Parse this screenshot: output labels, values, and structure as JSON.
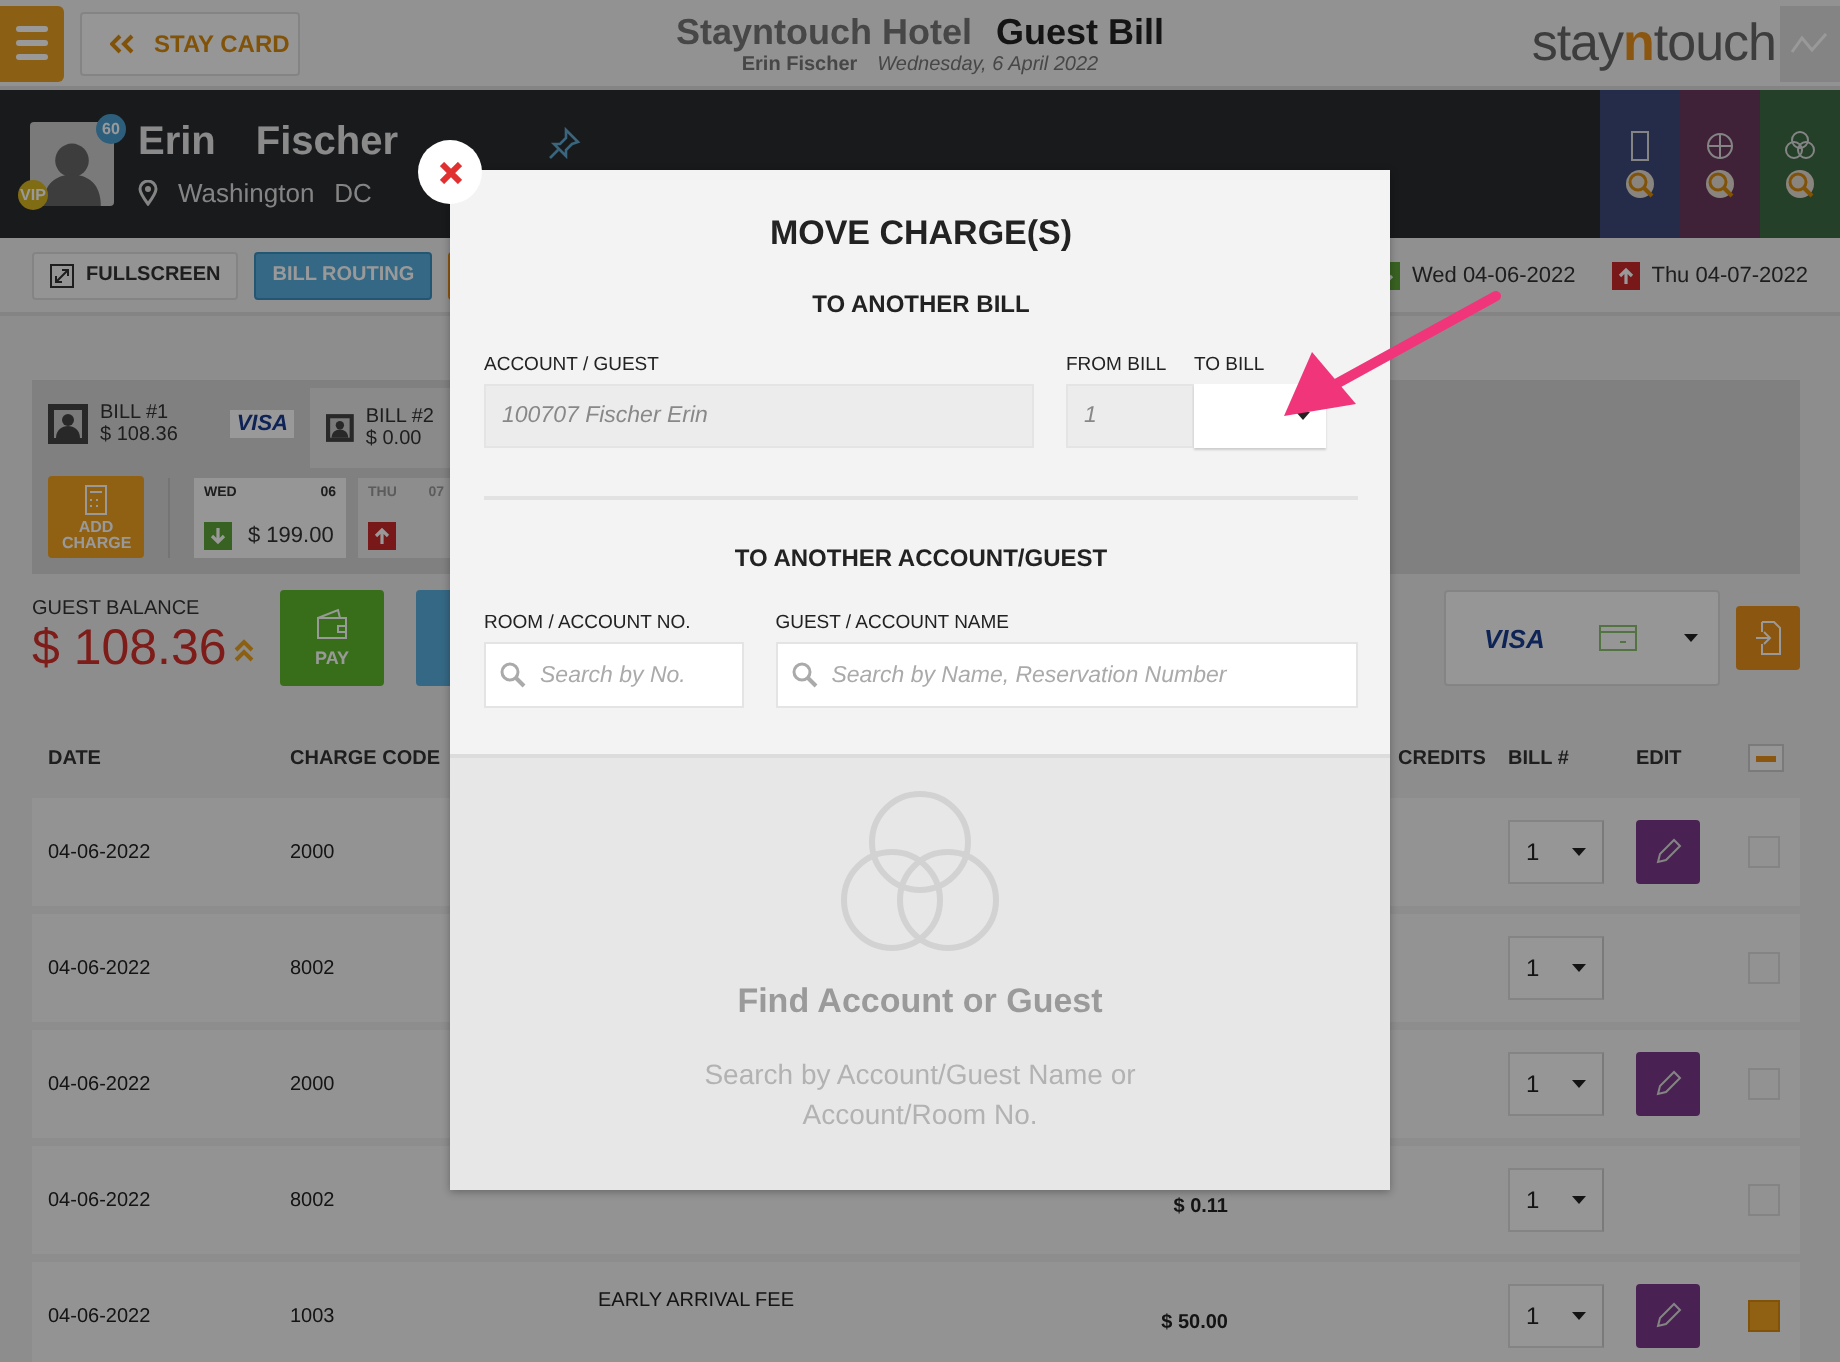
{
  "header": {
    "back_button": "STAY CARD",
    "hotel": "Stayntouch Hotel",
    "page_title": "Guest Bill",
    "guest_name": "Erin Fischer",
    "date": "Wednesday, 6 April 2022",
    "logo": {
      "before": "stay",
      "accent": "n",
      "after": "touch"
    }
  },
  "guest": {
    "first_name": "Erin",
    "last_name": "Fischer",
    "city": "Washington",
    "state": "DC",
    "loyalty_points": "60",
    "vip_badge": "VIP"
  },
  "toolbar": {
    "buttons": [
      {
        "label": "FULLSCREEN",
        "kind": "fullscreen"
      },
      {
        "label": "BILL ROUTING",
        "kind": "routing"
      }
    ],
    "arrival": "Wed 04-06-2022",
    "departure": "Thu 04-07-2022"
  },
  "bills": [
    {
      "label": "BILL #1",
      "amount": "$ 108.36",
      "selected": true,
      "card": "VISA"
    },
    {
      "label": "BILL #2",
      "amount": "$ 0.00",
      "selected": false
    }
  ],
  "add_charge": "ADD CHARGE",
  "days": [
    {
      "day": "WED",
      "date": "06",
      "amount": "$ 199.00",
      "kind": "arrival",
      "selected": true
    },
    {
      "day": "THU",
      "date": "07",
      "kind": "departure",
      "selected": false
    }
  ],
  "balance": {
    "label": "GUEST BALANCE",
    "amount": "$ 108.36",
    "pay": "PAY",
    "card": "VISA"
  },
  "table": {
    "headers": {
      "date": "DATE",
      "code": "CHARGE CODE",
      "credits": "CREDITS",
      "bill": "BILL #",
      "edit": "EDIT"
    },
    "select_all_partial": true,
    "rows": [
      {
        "date": "04-06-2022",
        "code": "2000",
        "bill": "1",
        "editable": true,
        "checked": false
      },
      {
        "date": "04-06-2022",
        "code": "8002",
        "bill": "1",
        "editable": false,
        "checked": false
      },
      {
        "date": "04-06-2022",
        "code": "2000",
        "bill": "1",
        "editable": true,
        "checked": false
      },
      {
        "date": "04-06-2022",
        "code": "8002",
        "amount": "$ 0.11",
        "bill": "1",
        "editable": false,
        "checked": false
      },
      {
        "date": "04-06-2022",
        "code": "1003",
        "description": "EARLY ARRIVAL FEE",
        "amount": "$ 50.00",
        "bill": "1",
        "editable": true,
        "checked": true
      }
    ]
  },
  "modal": {
    "title": "MOVE CHARGE(S)",
    "bill_section": "TO ANOTHER BILL",
    "account_label": "ACCOUNT / GUEST",
    "account_value": "100707 Fischer Erin",
    "from_label": "FROM BILL",
    "from_value": "1",
    "to_label": "TO BILL",
    "account_section": "TO ANOTHER ACCOUNT/GUEST",
    "room_label": "ROOM / ACCOUNT NO.",
    "room_placeholder": "Search by No.",
    "guest_label": "GUEST / ACCOUNT NAME",
    "guest_placeholder": "Search by Name, Reservation Number",
    "empty_title": "Find Account or Guest",
    "empty_text": "Search by Account/Guest Name or Account/Room No."
  }
}
